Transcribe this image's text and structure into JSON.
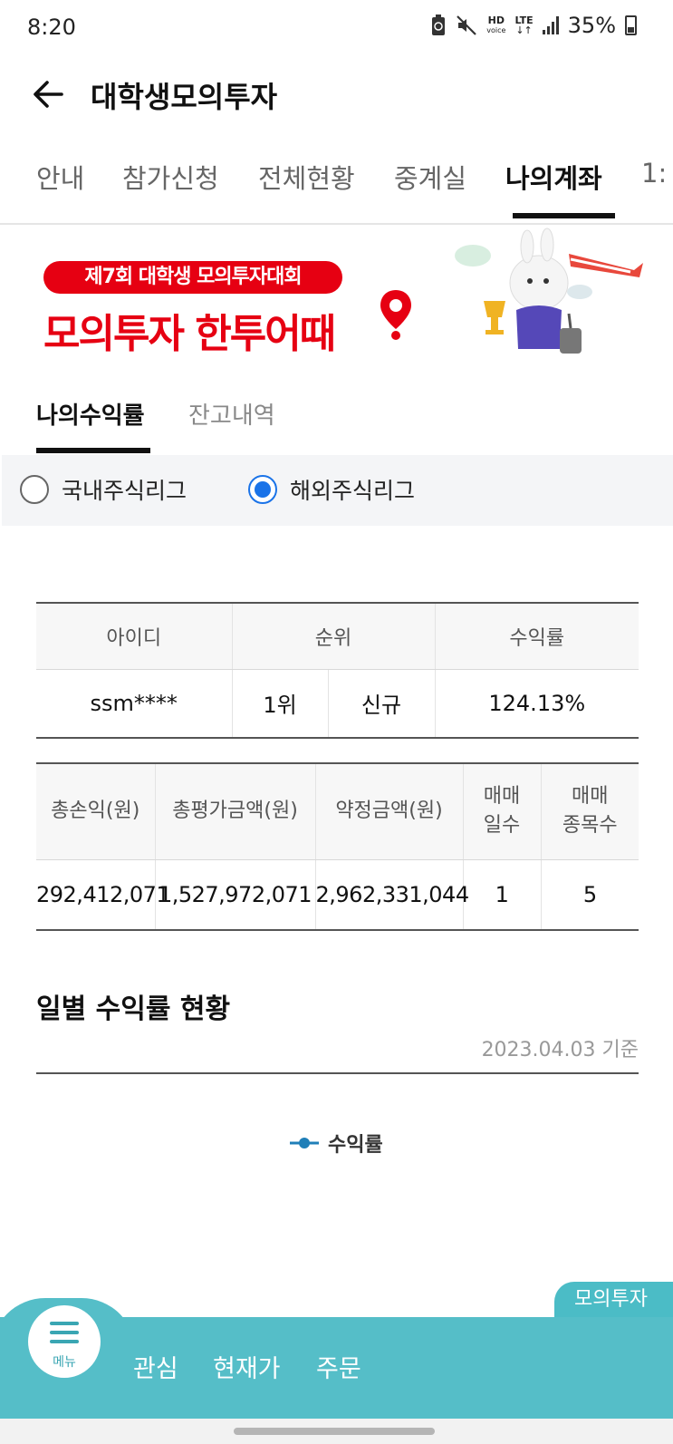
{
  "status_bar": {
    "time": "8:20",
    "hd_label": "HD",
    "voice_label": "voice",
    "lte_label": "LTE",
    "battery": "35%"
  },
  "header": {
    "title": "대학생모의투자"
  },
  "top_tabs": [
    {
      "label": "안내"
    },
    {
      "label": "참가신청"
    },
    {
      "label": "전체현황"
    },
    {
      "label": "중계실"
    },
    {
      "label": "나의계좌",
      "active": true
    },
    {
      "label": "1:"
    }
  ],
  "banner": {
    "event": "제7회 대학생 모의투자대회",
    "slogan": "모의투자 한투어때"
  },
  "sub_tabs": [
    {
      "label": "나의수익률",
      "active": true
    },
    {
      "label": "잔고내역"
    }
  ],
  "league": {
    "domestic": "국내주식리그",
    "overseas": "해외주식리그",
    "selected": "해외주식리그"
  },
  "rank_table": {
    "headers": {
      "id": "아이디",
      "rank": "순위",
      "return": "수익률"
    },
    "row": {
      "id": "ssm****",
      "rank": "1위",
      "status": "신규",
      "return": "124.13%"
    }
  },
  "stat_table": {
    "headers": {
      "total_pnl": "총손익(원)",
      "total_eval": "총평가금액(원)",
      "contract": "약정금액(원)",
      "trade_days_1": "매매",
      "trade_days_2": "일수",
      "trade_items_1": "매매",
      "trade_items_2": "종목수"
    },
    "row": {
      "total_pnl": "292,412,071",
      "total_eval": "1,527,972,071",
      "contract": "2,962,331,044",
      "trade_days": "1",
      "trade_items": "5"
    }
  },
  "daily": {
    "title": "일별 수익률 현황",
    "date": "2023.04.03 기준",
    "legend": "수익률"
  },
  "bottom_nav": {
    "tag": "모의투자",
    "menu_label": "메뉴",
    "items": [
      {
        "label": "관심"
      },
      {
        "label": "현재가"
      },
      {
        "label": "주문"
      }
    ]
  },
  "colors": {
    "accent": "#1a73e8",
    "brand_red": "#e60012",
    "nav_teal": "#55bec8"
  }
}
